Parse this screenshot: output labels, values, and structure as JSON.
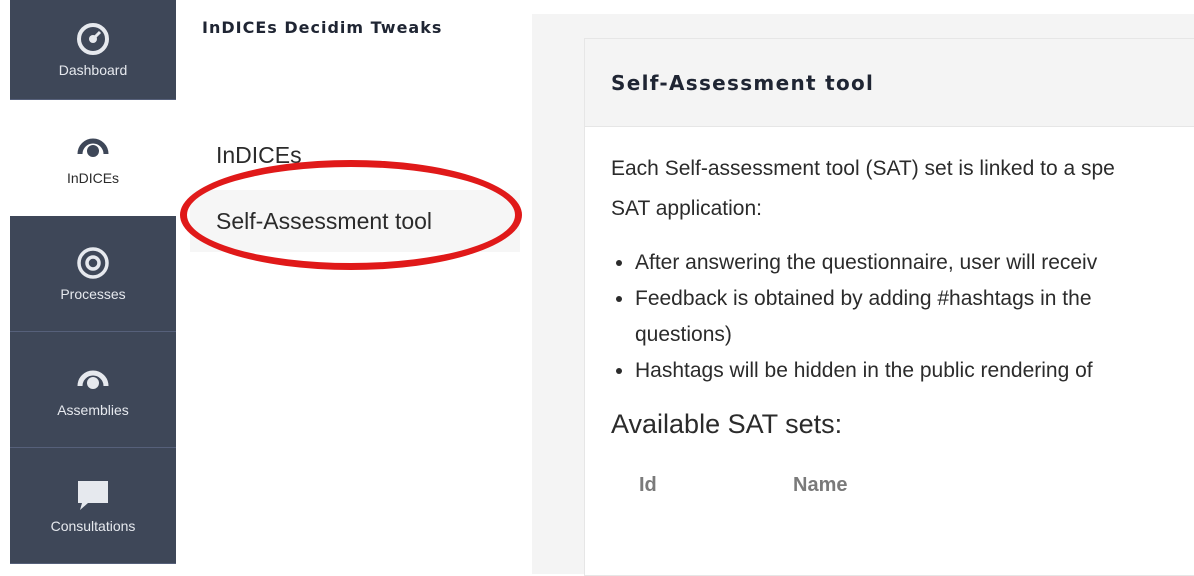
{
  "sidebar": {
    "items": [
      {
        "label": "Dashboard",
        "icon": "dashboard-icon"
      },
      {
        "label": "InDICEs",
        "icon": "indices-icon",
        "active": true
      },
      {
        "label": "Processes",
        "icon": "processes-icon"
      },
      {
        "label": "Assemblies",
        "icon": "assemblies-icon"
      },
      {
        "label": "Consultations",
        "icon": "consultations-icon"
      }
    ]
  },
  "secondary": {
    "title": "InDICEs Decidim Tweaks",
    "items": [
      {
        "label": "InDICEs"
      },
      {
        "label": "Self-Assessment tool",
        "active": true
      }
    ]
  },
  "main": {
    "card_title": "Self-Assessment tool",
    "intro_line1": "Each Self-assessment tool (SAT) set is linked to a spe",
    "intro_line2": "SAT application:",
    "bullets": [
      "After answering the questionnaire, user will receiv",
      "Feedback is obtained by adding #hashtags in the",
      "questions)",
      "Hashtags will be hidden in the public rendering of"
    ],
    "subheading": "Available SAT sets:",
    "table_headers": {
      "id": "Id",
      "name": "Name"
    }
  },
  "colors": {
    "sidebar_bg": "#3e4758",
    "annotation_circle": "#e01919",
    "panel_bg": "#f4f4f4"
  }
}
